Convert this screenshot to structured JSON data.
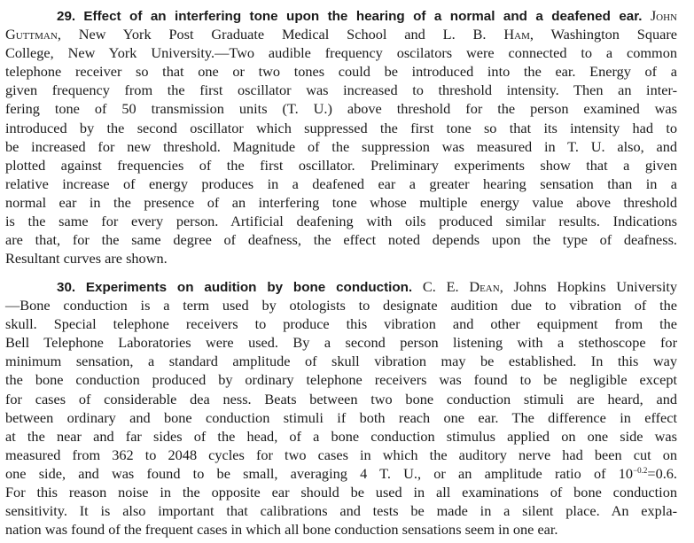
{
  "abstracts": [
    {
      "number": "29.",
      "title": "Effect of an interfering tone upon the hearing of a normal and a deafened ear.",
      "author1": "John Guttman",
      "rest_first": ", New York Post Graduate Medical School and L. B.",
      "author2": "Ham",
      "lines": [
        ", Washington Square",
        "College, New York University.—Two audible frequency oscilators were connected to a common",
        "telephone receiver so that one or two tones could be introduced into the ear. Energy of a",
        "given frequency from the first oscillator was increased to threshold intensity. Then an inter-",
        "fering tone of 50 transmission units (T. U.) above threshold for the person examined was",
        "introduced by the second oscillator which suppressed the first tone so that its intensity had to",
        "be increased for new threshold. Magnitude of the suppression was measured in T. U. also, and",
        "plotted against frequencies of the first oscillator. Preliminary experiments show that a given",
        "relative increase of energy produces in a deafened ear a greater hearing sensation than in a",
        "normal ear in the presence of an interfering tone whose multiple energy value above threshold",
        "is the same for every person. Artificial deafening with oils produced similar results. Indications",
        "are that, for the same degree of deafness, the effect noted depends upon the type of deafness.",
        "Resultant curves are shown."
      ]
    },
    {
      "number": "30.",
      "title": "Experiments on audition by bone conduction.",
      "author1": "C. E. Dean",
      "rest_first": ", Johns Hopkins University",
      "lines": [
        "—Bone conduction is a term used by otologists to designate audition due to vibration of the",
        "skull. Special telephone receivers to produce this vibration and other equipment from the",
        "Bell Telephone Laboratories were used. By a second person listening with a stethoscope for",
        "minimum sensation, a standard amplitude of skull vibration may be established. In this way",
        "the bone conduction produced by ordinary telephone receivers was found to be negligible except",
        "for cases of considerable dea ness. Beats between two bone conduction stimuli are heard, and",
        "between ordinary and bone conduction stimuli if both reach one ear. The difference in effect",
        "at the near and far sides of the head, of a bone conduction stimulus applied on one side was",
        "measured from 362 to 2048 cycles for two cases in which the auditory nerve had been cut on",
        "one side, and was found to be small, averaging 4 T. U., or an amplitude ratio of 10",
        "For this reason noise in the opposite ear should be used in all examinations of bone conduction",
        "sensitivity. It is also important that calibrations and tests be made in a silent place. An expla-",
        "nation was found of the frequent cases in which all bone conduction sensations seem in one ear."
      ],
      "ratio_exponent": "−0.2",
      "ratio_result": "=0.6."
    }
  ]
}
